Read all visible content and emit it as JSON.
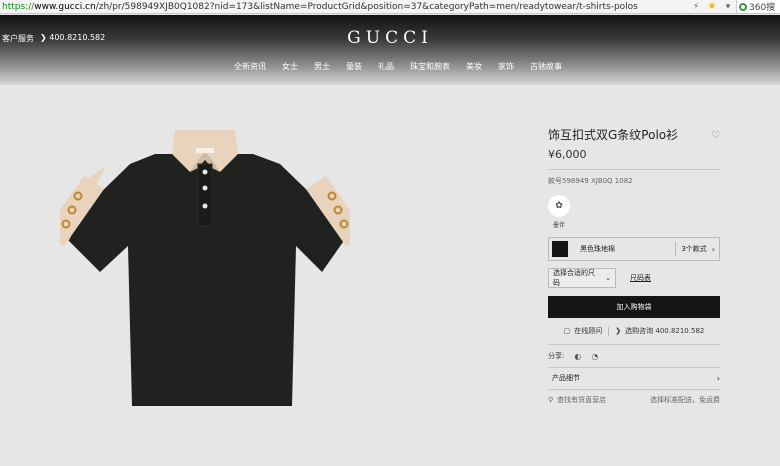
{
  "browser": {
    "url_scheme": "https://",
    "url_host": "www.gucci.cn",
    "url_path": "/zh/pr/598949XJB0Q1082?nid=173&listName=ProductGrid&position=37&categoryPath=men/readytowear/t-shirts-polos",
    "search_engine": "360搜"
  },
  "header": {
    "service": "客户服务",
    "phone": "400.8210.582",
    "logo": "GUCCI",
    "nav": [
      "全新资讯",
      "女士",
      "男士",
      "童装",
      "礼品",
      "珠宝和腕表",
      "美妆",
      "家饰",
      "古驰故事"
    ]
  },
  "product": {
    "title": "饰互扣式双G条纹Polo衫",
    "price": "¥6,000",
    "code": "款号598949 XJB0Q 1082",
    "swatch_label": "墨伴",
    "variant_name": "黑色珠地棉",
    "variant_count": "3个款式",
    "size_select": "选择合适的尺码",
    "size_guide": "尺码表",
    "add_to_cart": "加入购物袋",
    "online_consult": "在线顾问",
    "phone_consult": "选购咨询 400.8210.582",
    "share_label": "分享:",
    "details_label": "产品细节",
    "store_label": "查找有货直营店",
    "store_note": "选择标准配送，免运费"
  },
  "colors": {
    "header_top": "#121212",
    "background": "#e6e6e6",
    "shirt": "#1f221f",
    "collar": "#ead3bd",
    "cart_button": "#151515"
  }
}
